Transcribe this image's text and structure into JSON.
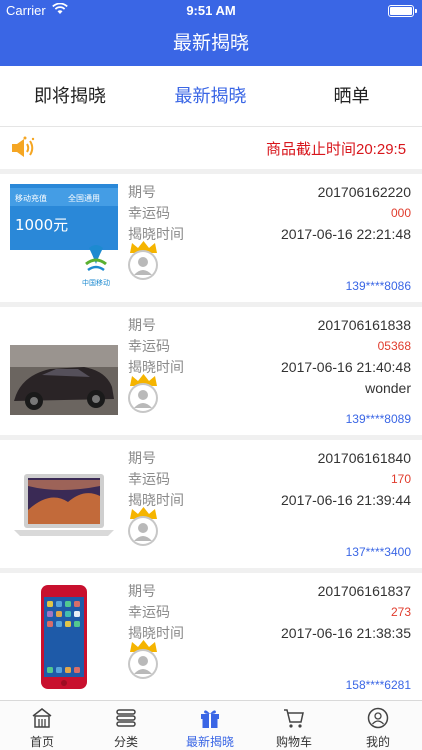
{
  "statusbar": {
    "carrier": "Carrier",
    "time": "9:51 AM"
  },
  "navbar": {
    "title": "最新揭晓"
  },
  "tabs": [
    {
      "label": "即将揭晓"
    },
    {
      "label": "最新揭晓"
    },
    {
      "label": "晒单"
    }
  ],
  "notice": {
    "text": "商品截止时间20:29:5"
  },
  "labels": {
    "period": "期号",
    "lucky": "幸运码",
    "reveal_time": "揭晓时间"
  },
  "cards": [
    {
      "image": "china-mobile-recharge-card",
      "image_text_1": "移动充值",
      "image_text_2": "全国通用",
      "image_text_3": "1000元",
      "image_text_4": "中国移动",
      "period": "201706162220",
      "lucky": "000",
      "time": "2017-06-16 22:21:48",
      "winner": "",
      "phone": "139****8086"
    },
    {
      "image": "car-photo",
      "period": "201706161838",
      "lucky": "05368",
      "time": "2017-06-16 21:40:48",
      "winner": "wonder",
      "phone": "139****8089"
    },
    {
      "image": "macbook-laptop",
      "period": "201706161840",
      "lucky": "170",
      "time": "2017-06-16 21:39:44",
      "winner": "",
      "phone": "137****3400"
    },
    {
      "image": "red-iphone",
      "period": "201706161837",
      "lucky": "273",
      "time": "2017-06-16 21:38:35",
      "winner": "",
      "phone": "158****6281"
    }
  ],
  "tabbar": [
    {
      "label": "首页",
      "icon": "home-icon"
    },
    {
      "label": "分类",
      "icon": "category-icon"
    },
    {
      "label": "最新揭晓",
      "icon": "gift-icon"
    },
    {
      "label": "购物车",
      "icon": "cart-icon"
    },
    {
      "label": "我的",
      "icon": "profile-icon"
    }
  ],
  "colors": {
    "brand": "#3a66e5",
    "notice": "#d8161c",
    "lucky": "#e03c2d",
    "crown": "#f5b400"
  }
}
